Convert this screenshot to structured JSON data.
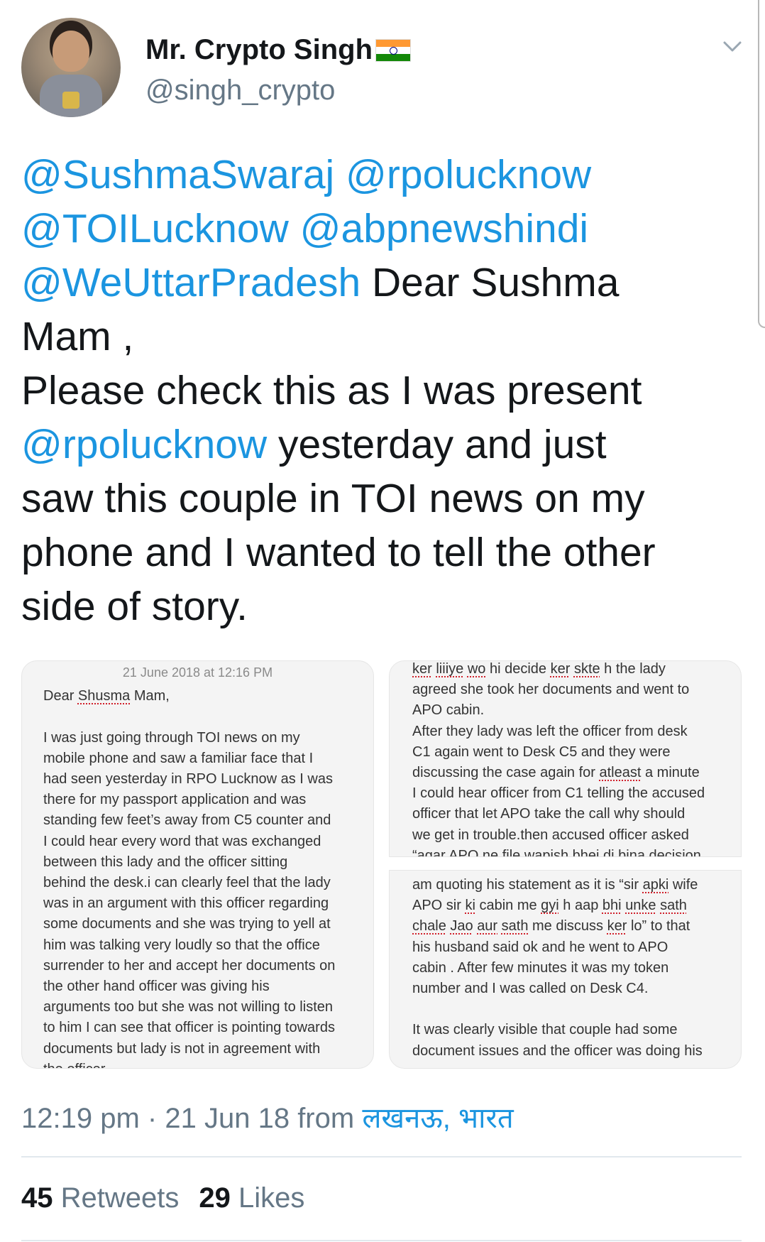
{
  "tweet": {
    "author_name": "Mr. Crypto Singh",
    "author_handle": "@singh_crypto",
    "text_lines": [
      [
        {
          "t": "@SushmaSwaraj",
          "m": true
        },
        {
          "t": " ",
          "m": false
        },
        {
          "t": "@rpolucknow",
          "m": true
        }
      ],
      [
        {
          "t": "@TOILucknow",
          "m": true
        },
        {
          "t": " ",
          "m": false
        },
        {
          "t": "@abpnewshindi",
          "m": true
        }
      ],
      [
        {
          "t": "@WeUttarPradesh",
          "m": true
        },
        {
          "t": " Dear Sushma",
          "m": false
        }
      ],
      [
        {
          "t": "Mam ,",
          "m": false
        }
      ],
      [
        {
          "t": "Please check this as I was present",
          "m": false
        }
      ],
      [
        {
          "t": "@rpolucknow",
          "m": true
        },
        {
          "t": " yesterday and just",
          "m": false
        }
      ],
      [
        {
          "t": "saw this couple in TOI news on my",
          "m": false
        }
      ],
      [
        {
          "t": "phone and I wanted to tell the other",
          "m": false
        }
      ],
      [
        {
          "t": "side of story.",
          "m": false
        }
      ]
    ],
    "time": "12:19 pm",
    "separator": "·",
    "date": "21 Jun 18",
    "from_label": "from",
    "location": "लखनऊ, भारत",
    "retweets_count": "45",
    "retweets_label": "Retweets",
    "likes_count": "29",
    "likes_label": "Likes"
  },
  "note_left": {
    "date": "21 June 2018 at 12:16 PM",
    "lines": [
      "Dear [Shusma] Mam,",
      "",
      "I was just going through TOI news on my",
      "mobile phone and saw a familiar face that I",
      "had seen yesterday in RPO Lucknow as I was",
      "there for my passport application and was",
      "standing few feet’s away from C5 counter and",
      "I could hear every word that was exchanged",
      "between this lady and the officer sitting",
      "behind the desk.i can clearly feel that the lady",
      "was in an argument with this officer regarding",
      "some documents and she was trying to yell at",
      "him was talking very loudly so that the office",
      "surrender to her and accept her documents on",
      "the other hand officer was giving his",
      "arguments too but she was not willing to listen",
      "to him I can see that officer is pointing towards",
      "documents but lady is not in agreement with"
    ],
    "cut_line": "the officer"
  },
  "note_right_top": {
    "lines": [
      "[ker] [liiiye] [wo] hi decide [ker] [skte] h the lady",
      "agreed she took her documents and went to",
      "APO cabin.",
      "After they lady was left the officer from desk",
      "C1 again went to Desk C5 and they were",
      "discussing the case again for [atleast] a minute",
      "I could hear officer from C1 telling the accused",
      "officer that let APO take the call why should",
      "we get in trouble.then accused officer asked"
    ],
    "cut_line": "“agar APO ne file wapish bhej di bina decision"
  },
  "note_right_bottom": {
    "lines": [
      "am quoting his statement as it is “sir [apki] wife",
      "APO sir [ki] cabin me [gyi] h aap [bhi] [unke] [sath]",
      "[chale] [Jao] [aur] [sath] me discuss [ker] lo” to that",
      "his husband said ok and he went to APO",
      "cabin . After few minutes it was my token",
      "number and I was called on Desk C4.",
      "",
      "It was clearly visible that couple had some",
      "document issues and the officer was doing his"
    ]
  },
  "icons": {
    "caret": "chevron-down-icon",
    "flag": "india-flag-icon"
  },
  "colors": {
    "mention": "#1b95e0",
    "secondary": "#657786",
    "primary": "#14171a"
  }
}
